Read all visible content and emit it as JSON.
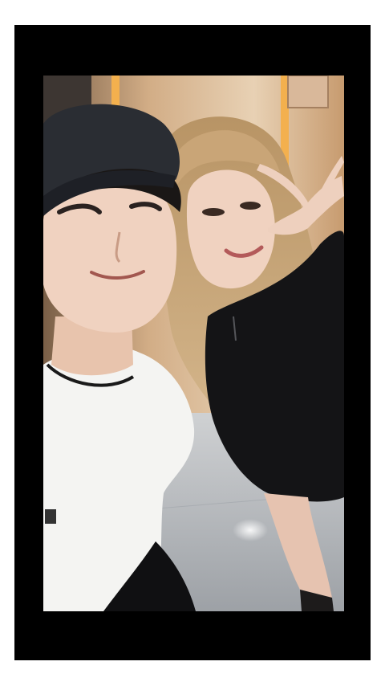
{
  "screen": {
    "background": "#ffffff",
    "frame_color": "#000000"
  },
  "photo": {
    "kind": "selfie photograph",
    "palette": {
      "wall_warm": "#c8a27a",
      "wall_light": "#e9d3b6",
      "light_strip": "#f3b04e",
      "floor": "#b9bcbf",
      "floor_dark": "#8d9196",
      "skin": "#f0d2c0",
      "skin_shadow": "#d8a994",
      "hair_blonde": "#c9a577",
      "hair_dark": "#1a1716",
      "cap": "#2a2d33",
      "white_shirt": "#f4f4f2",
      "black_top": "#141416"
    }
  }
}
